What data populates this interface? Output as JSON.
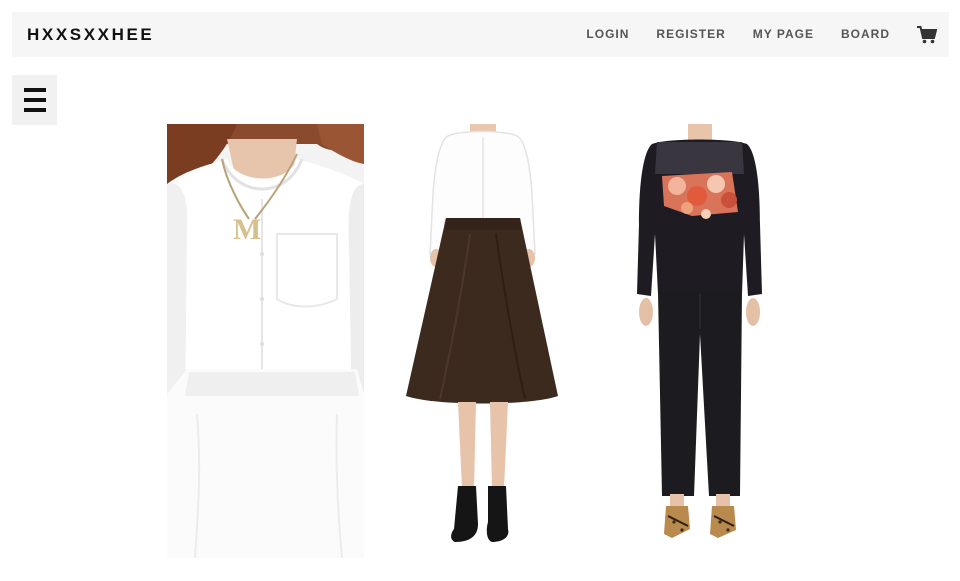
{
  "header": {
    "brand": "HXXSXXHEE",
    "nav": [
      {
        "label": "LOGIN"
      },
      {
        "label": "REGISTER"
      },
      {
        "label": "MY PAGE"
      },
      {
        "label": "BOARD"
      }
    ],
    "cart_icon": "shopping-cart-icon"
  },
  "menu": {
    "icon": "hamburger-menu-icon"
  },
  "products": [
    {
      "image": "white-blouse-white-skirt-necklace-photo"
    },
    {
      "image": "white-blouse-brown-midi-skirt-photo"
    },
    {
      "image": "black-floral-sweatshirt-black-pants-photo"
    }
  ],
  "colors": {
    "header_bg": "#f6f6f6",
    "brand": "#111111",
    "nav_text": "#555555",
    "icon": "#333333"
  }
}
